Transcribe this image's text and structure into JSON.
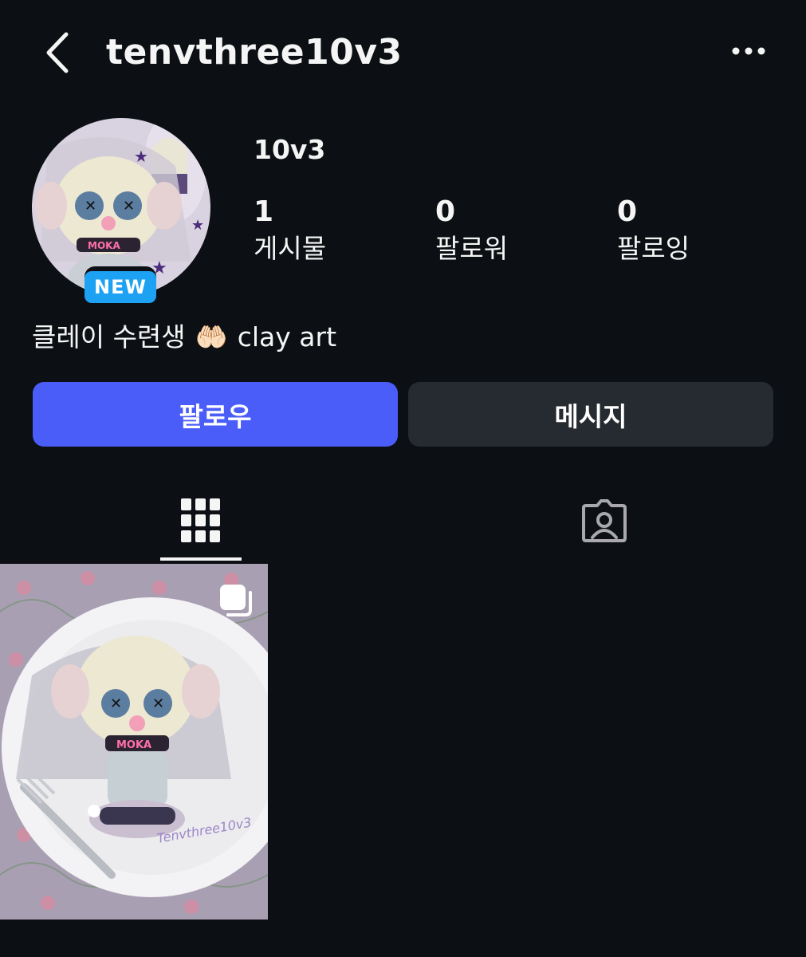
{
  "header": {
    "username": "tenvthree10v3",
    "back_icon": "chevron-left-icon",
    "more_icon": "more-horizontal-icon"
  },
  "profile": {
    "display_name": "10v3",
    "badge": "NEW",
    "stats": [
      {
        "count": "1",
        "label": "게시물"
      },
      {
        "count": "0",
        "label": "팔로워"
      },
      {
        "count": "0",
        "label": "팔로잉"
      }
    ],
    "bio": {
      "text_before": "클레이 수련생",
      "emoji": "🤲🏻",
      "text_after": "clay art"
    }
  },
  "actions": {
    "follow_label": "팔로우",
    "message_label": "메시지"
  },
  "tabs": [
    {
      "icon": "grid-icon",
      "active": true
    },
    {
      "icon": "tagged-person-icon",
      "active": false
    }
  ],
  "posts": [
    {
      "watermark": "Tenvthree10v3",
      "chest_text": "MOKA",
      "multiple": true
    }
  ],
  "colors": {
    "background": "#0c1014",
    "follow_button": "#4a5df9",
    "message_button": "#262a31",
    "new_badge": "#1da1f2"
  }
}
